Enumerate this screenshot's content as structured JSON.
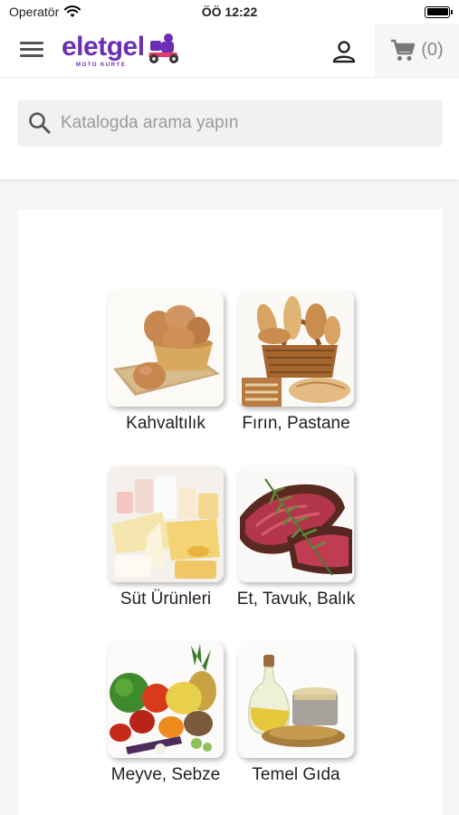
{
  "status": {
    "carrier": "Operatör",
    "time": "ÖÖ 12:22",
    "wifi_icon": "wifi-icon",
    "battery_icon": "battery-icon"
  },
  "header": {
    "menu_icon": "hamburger-menu-icon",
    "logo_text": "eletgel",
    "logo_subtext": "MOTO KURYE",
    "user_icon": "user-icon",
    "cart_icon": "cart-icon",
    "cart_count": "(0)"
  },
  "search": {
    "placeholder": "Katalogda arama yapın",
    "icon": "search-icon"
  },
  "categories": [
    {
      "label": "Kahvaltılık"
    },
    {
      "label": "Fırın, Pastane"
    },
    {
      "label": "Süt Ürünleri"
    },
    {
      "label": "Et, Tavuk, Balık"
    },
    {
      "label": "Meyve, Sebze"
    },
    {
      "label": "Temel Gıda"
    }
  ],
  "colors": {
    "brand": "#6a2fb3",
    "background": "#f6f6f6",
    "search_bg": "#f1f1f1"
  }
}
